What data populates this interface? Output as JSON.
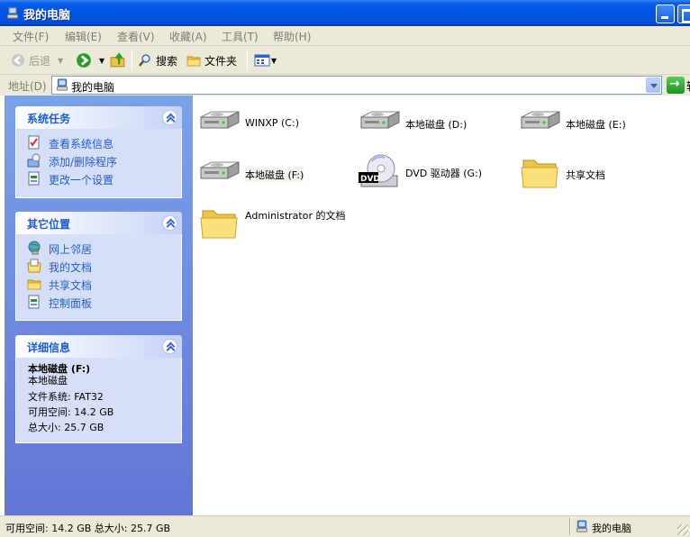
{
  "window": {
    "title": "我的电脑"
  },
  "menu": [
    "文件(F)",
    "编辑(E)",
    "查看(V)",
    "收藏(A)",
    "工具(T)",
    "帮助(H)"
  ],
  "toolbar": {
    "back": "后退",
    "search": "搜索",
    "folders": "文件夹"
  },
  "address": {
    "label": "地址(D)",
    "value": "我的电脑",
    "go": "转"
  },
  "tasks": {
    "system": {
      "title": "系统任务",
      "items": [
        "查看系统信息",
        "添加/删除程序",
        "更改一个设置"
      ]
    },
    "places": {
      "title": "其它位置",
      "items": [
        "网上邻居",
        "我的文档",
        "共享文档",
        "控制面板"
      ]
    },
    "details": {
      "title": "详细信息",
      "name": "本地磁盘 (F:)",
      "type": "本地磁盘",
      "fs": "文件系统: FAT32",
      "free": "可用空间: 14.2 GB",
      "total": "总大小: 25.7 GB"
    }
  },
  "items": [
    {
      "label": "WINXP (C:)",
      "icon": "hard-disk-icon"
    },
    {
      "label": "本地磁盘 (D:)",
      "icon": "hard-disk-icon"
    },
    {
      "label": "本地磁盘 (E:)",
      "icon": "hard-disk-icon"
    },
    {
      "label": "本地磁盘 (F:)",
      "icon": "hard-disk-icon",
      "selected": true
    },
    {
      "label": "DVD 驱动器 (G:)",
      "icon": "dvd-drive-icon"
    },
    {
      "label": "共享文档",
      "icon": "folder-icon"
    },
    {
      "label": "Administrator 的文档",
      "icon": "folder-icon"
    }
  ],
  "status": {
    "left": "可用空间: 14.2 GB 总大小: 25.7 GB",
    "right": "我的电脑"
  },
  "colors": {
    "titlebar": "#0054e3",
    "taskpane": "#7ba2e7",
    "panel_title": "#215dc6",
    "panel_body": "#d6dff7"
  }
}
